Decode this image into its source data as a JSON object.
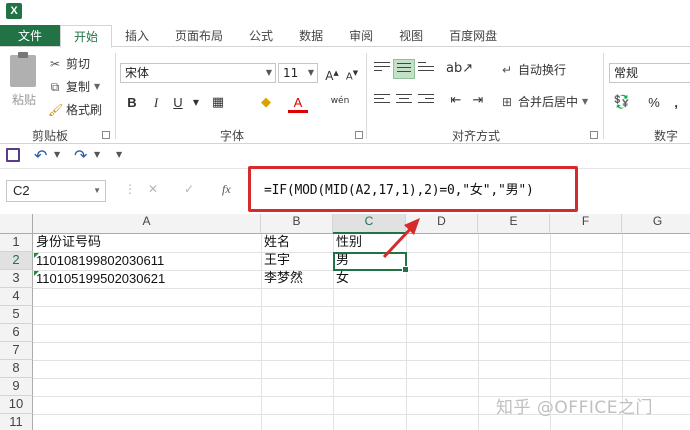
{
  "app": {
    "icon_label": "X"
  },
  "tabs": [
    "文件",
    "开始",
    "插入",
    "页面布局",
    "公式",
    "数据",
    "审阅",
    "视图",
    "百度网盘"
  ],
  "clipboard": {
    "paste": "粘贴",
    "cut": "剪切",
    "copy": "复制",
    "format_painter": "格式刷",
    "group": "剪贴板"
  },
  "font": {
    "name": "宋体",
    "size": "11",
    "bold": "B",
    "italic": "I",
    "underline": "U",
    "phonetic": "wén",
    "group": "字体"
  },
  "alignment": {
    "wrap": "自动换行",
    "merge": "合并后居中",
    "group": "对齐方式"
  },
  "number": {
    "format": "常规",
    "percent": "%",
    "comma": ",",
    "group": "数字"
  },
  "formula_bar": {
    "name_box": "C2",
    "fx": "fx",
    "cancel": "✕",
    "enter": "✓",
    "formula": "=IF(MOD(MID(A2,17,1),2)=0,\"女\",\"男\")"
  },
  "columns": [
    "A",
    "B",
    "C",
    "D",
    "E",
    "F",
    "G"
  ],
  "rows": [
    "1",
    "2",
    "3",
    "4",
    "5",
    "6",
    "7",
    "8",
    "9",
    "10",
    "11"
  ],
  "cells": {
    "A1": "身份证号码",
    "B1": "姓名",
    "C1": "性别",
    "A2": "110108199802030611",
    "B2": "王宇",
    "C2": "男",
    "A3": "110105199502030621",
    "B3": "李梦然",
    "C3": "女"
  },
  "watermark": "知乎 @OFFICE之门",
  "colors": {
    "accent": "#217346",
    "highlight": "#d62b2b"
  }
}
